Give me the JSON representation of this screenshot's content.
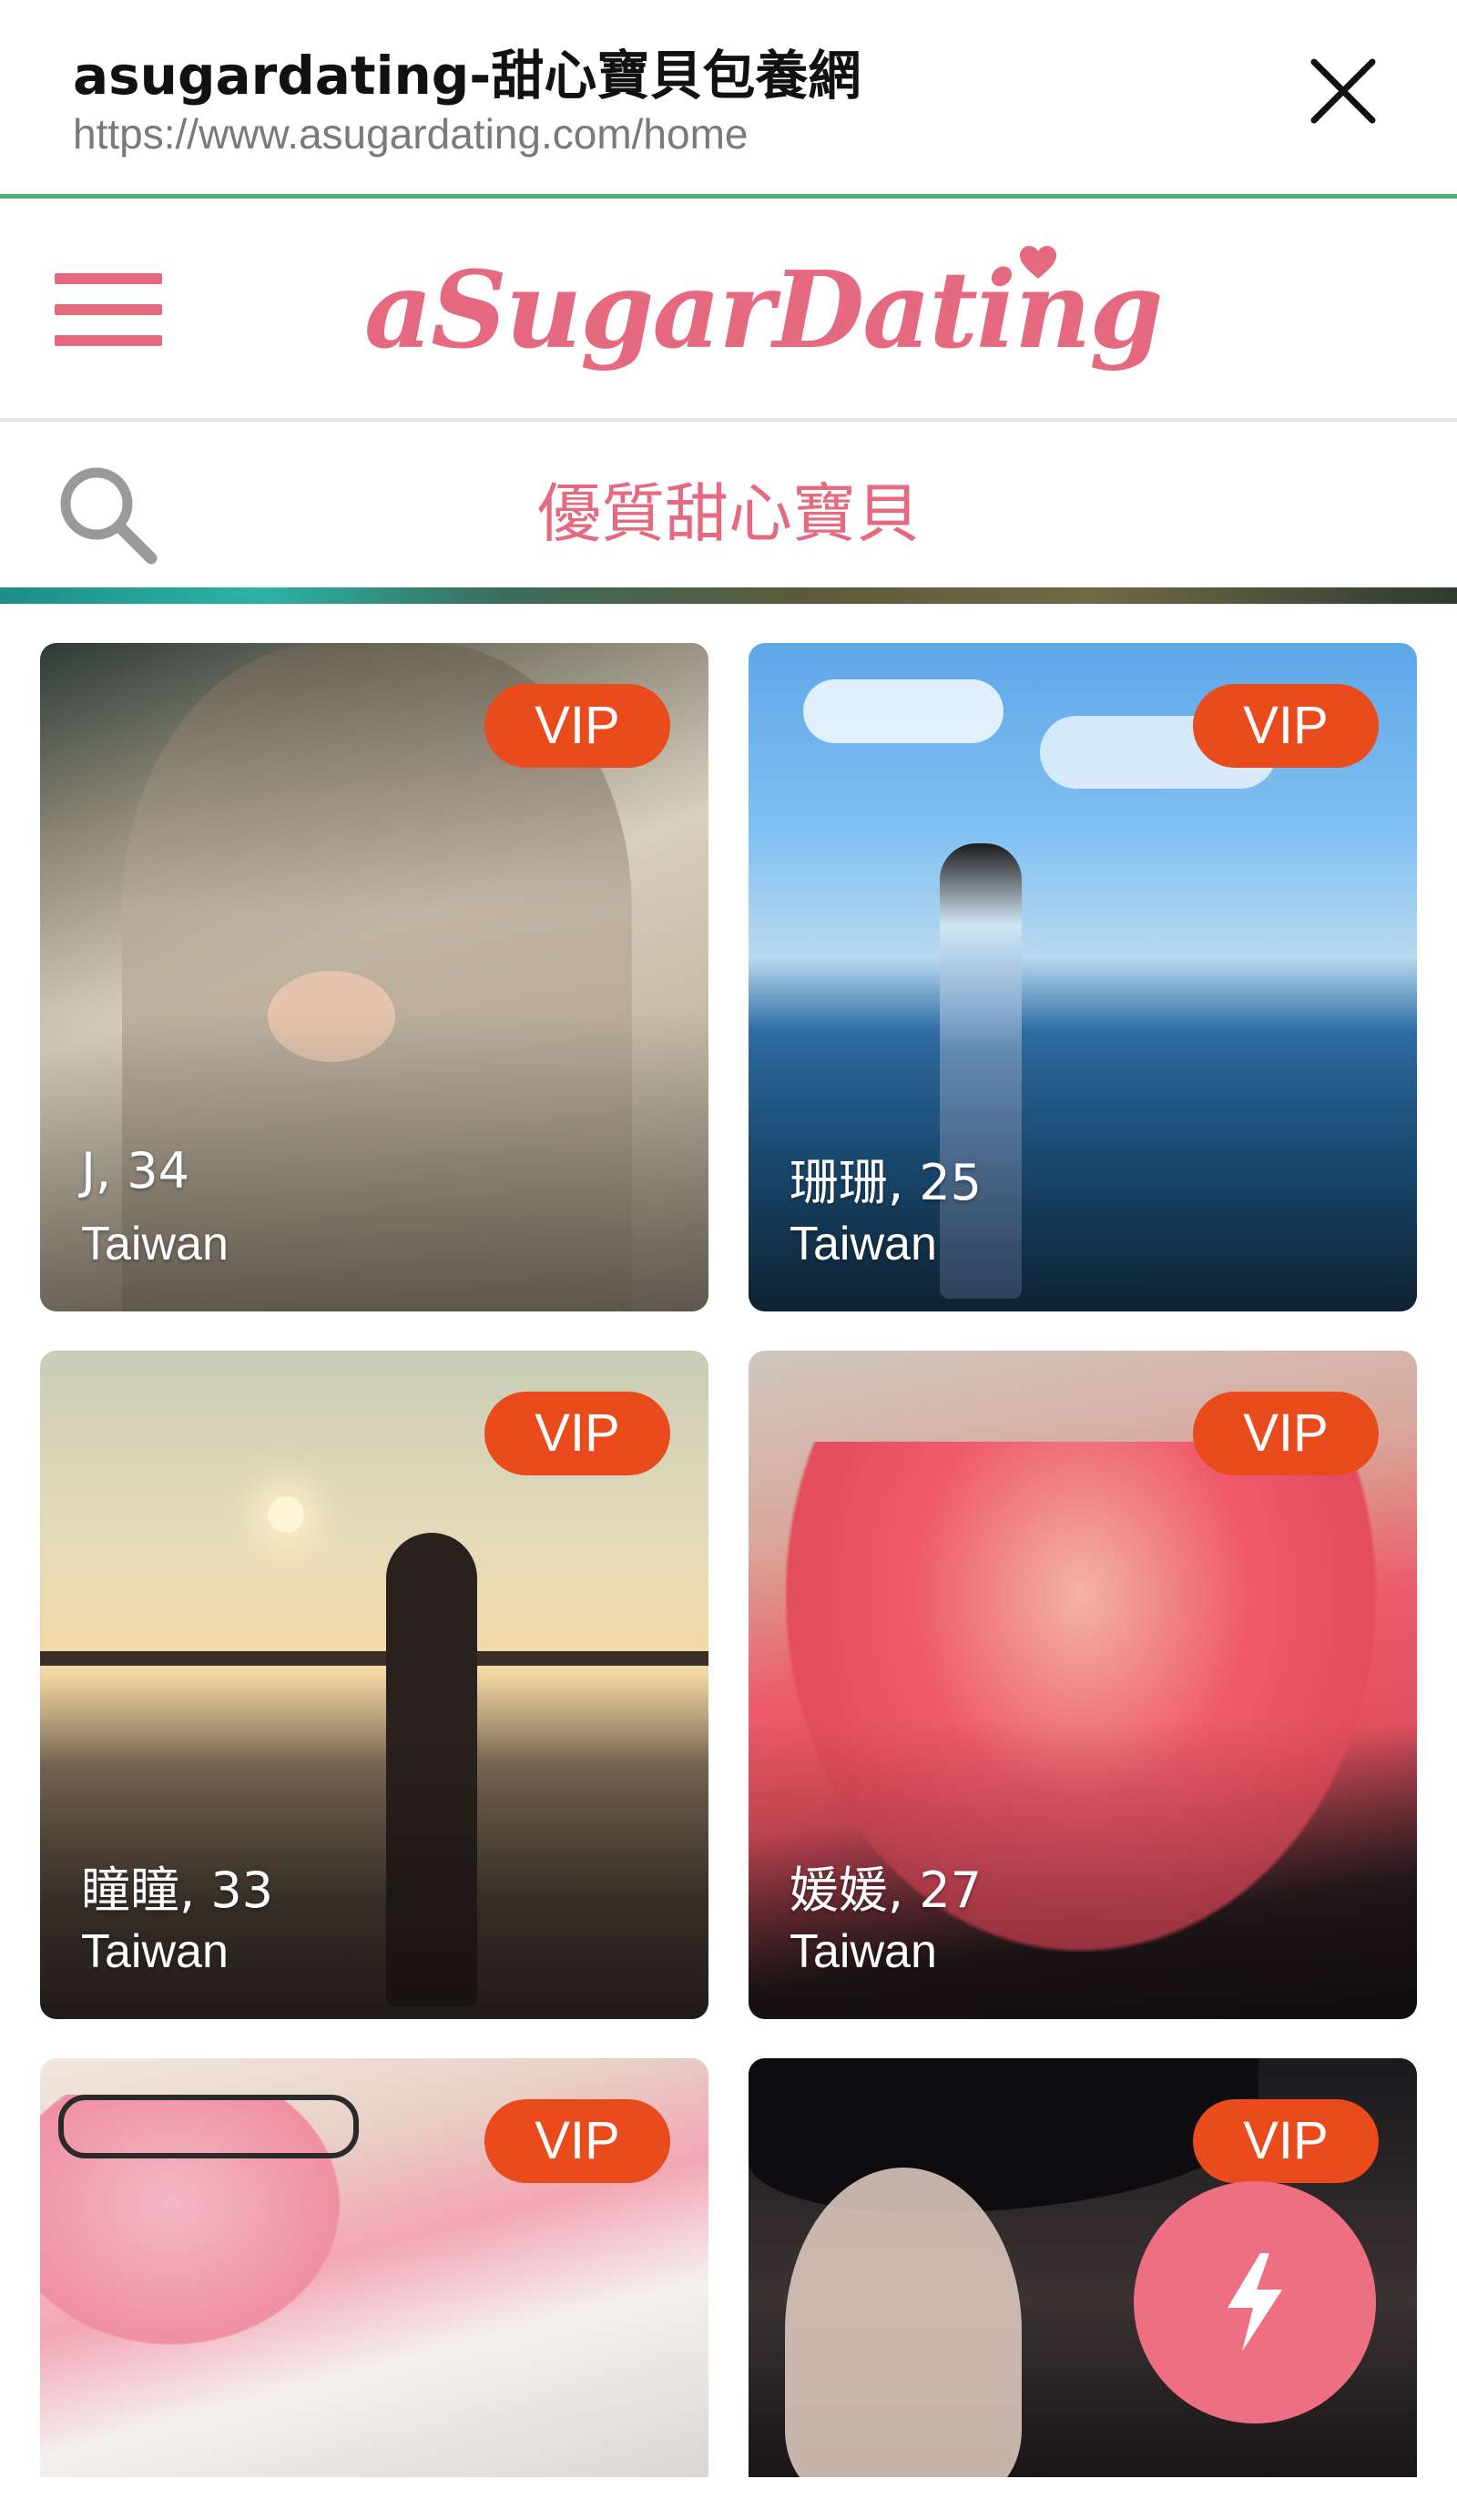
{
  "browser": {
    "title": "asugardating-甜心寶貝包養網",
    "url": "https://www.asugardating.com/home",
    "close_icon": "close-icon",
    "accent_color": "#4caf6e"
  },
  "header": {
    "menu_icon": "hamburger-menu-icon",
    "logo_text": "aSugarDating",
    "brand_color": "#e56a80"
  },
  "section": {
    "search_icon": "search-icon",
    "title": "優質甜心寶貝"
  },
  "profiles": [
    {
      "badge": "VIP",
      "name_age": "J, 34",
      "location": "Taiwan"
    },
    {
      "badge": "VIP",
      "name_age": "珊珊, 25",
      "location": "Taiwan"
    },
    {
      "badge": "VIP",
      "name_age": "瞳瞳, 33",
      "location": "Taiwan"
    },
    {
      "badge": "VIP",
      "name_age": "媛媛, 27",
      "location": "Taiwan"
    },
    {
      "badge": "VIP",
      "name_age": "",
      "location": ""
    },
    {
      "badge": "VIP",
      "name_age": "",
      "location": ""
    }
  ],
  "fab": {
    "icon": "lightning-bolt-icon",
    "color": "#ef6f82"
  },
  "badge_color": "#e94b1c"
}
